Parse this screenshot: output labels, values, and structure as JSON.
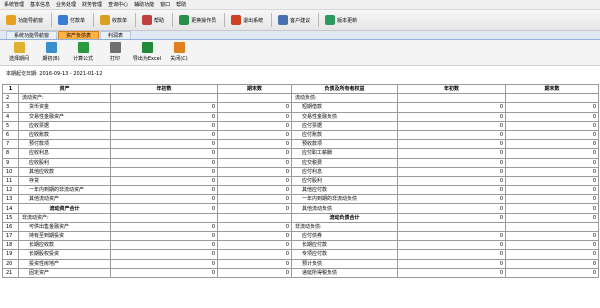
{
  "menu": [
    "系统管理",
    "基本信息",
    "业务处理",
    "财务管理",
    "查询中心",
    "辅助功能",
    "窗口",
    "帮助"
  ],
  "toolbar": [
    {
      "label": "功能导航窗",
      "icon": "home-icon",
      "color": "#e8a020"
    },
    {
      "label": "付款单",
      "icon": "payment-icon",
      "color": "#3a7bd5"
    },
    {
      "label": "收款单",
      "icon": "receipt-icon",
      "color": "#d9a020"
    },
    {
      "label": "帮助",
      "icon": "help-icon",
      "color": "#c04040"
    },
    {
      "label": "更换操作员",
      "icon": "switch-user-icon",
      "color": "#2a8f4a"
    },
    {
      "label": "退出系统",
      "icon": "exit-icon",
      "color": "#d04020"
    },
    {
      "label": "客户建议",
      "icon": "suggestion-icon",
      "color": "#4a6fb0"
    },
    {
      "label": "版本更新",
      "icon": "update-icon",
      "color": "#2a9a60"
    }
  ],
  "tabs": [
    "系统功能导航窗",
    "资产负债表",
    "利润表"
  ],
  "active_tab": 1,
  "toolbar2": [
    {
      "label": "选择期间",
      "icon": "calendar-icon",
      "color": "#e0b030"
    },
    {
      "label": "期初(B)",
      "icon": "refresh-icon",
      "color": "#3a8fd0"
    },
    {
      "label": "计算公式",
      "icon": "formula-icon",
      "color": "#2a9a40"
    },
    {
      "label": "打印",
      "icon": "print-icon",
      "color": "#707070"
    },
    {
      "label": "导出为Excel",
      "icon": "excel-icon",
      "color": "#1f8a3a"
    },
    {
      "label": "关闭(C)",
      "icon": "close-icon",
      "color": "#e08020"
    }
  ],
  "period_text": "本期起讫日期: 2016-09-13 - 2021-01-12",
  "headers": [
    "资产",
    "年初数",
    "期末数",
    "负债及所有者权益",
    "年初数",
    "期末数"
  ],
  "rows": [
    {
      "no": "2",
      "a": "流动资产:",
      "a_style": "i0",
      "a1": "",
      "a2": "",
      "b": "流动负债:",
      "b_style": "i0",
      "b1": "",
      "b2": ""
    },
    {
      "no": "3",
      "a": "货币资金",
      "a_style": "i1",
      "a1": "0",
      "a2": "0",
      "b": "短期借款",
      "b_style": "i1",
      "b1": "0",
      "b2": "0"
    },
    {
      "no": "4",
      "a": "交易性金融资产",
      "a_style": "i1",
      "a1": "0",
      "a2": "0",
      "b": "交易性金融负债",
      "b_style": "i1",
      "b1": "0",
      "b2": "0"
    },
    {
      "no": "5",
      "a": "应收票据",
      "a_style": "i1",
      "a1": "0",
      "a2": "0",
      "b": "应付票据",
      "b_style": "i1",
      "b1": "0",
      "b2": "0"
    },
    {
      "no": "6",
      "a": "应收账款",
      "a_style": "i1",
      "a1": "0",
      "a2": "0",
      "b": "应付账款",
      "b_style": "i1",
      "b1": "0",
      "b2": "0"
    },
    {
      "no": "7",
      "a": "预付款项",
      "a_style": "i1",
      "a1": "0",
      "a2": "0",
      "b": "预收款项",
      "b_style": "i1",
      "b1": "0",
      "b2": "0"
    },
    {
      "no": "8",
      "a": "应收利息",
      "a_style": "i1",
      "a1": "0",
      "a2": "0",
      "b": "应付职工薪酬",
      "b_style": "i1",
      "b1": "0",
      "b2": "0"
    },
    {
      "no": "9",
      "a": "应收股利",
      "a_style": "i1",
      "a1": "0",
      "a2": "0",
      "b": "应交税费",
      "b_style": "i1",
      "b1": "0",
      "b2": "0"
    },
    {
      "no": "10",
      "a": "其他应收款",
      "a_style": "i1",
      "a1": "0",
      "a2": "0",
      "b": "应付利息",
      "b_style": "i1",
      "b1": "0",
      "b2": "0"
    },
    {
      "no": "11",
      "a": "存货",
      "a_style": "i1",
      "a1": "0",
      "a2": "0",
      "b": "应付股利",
      "b_style": "i1",
      "b1": "0",
      "b2": "0"
    },
    {
      "no": "12",
      "a": "一年内到期的非流动资产",
      "a_style": "i1",
      "a1": "0",
      "a2": "0",
      "b": "其他应付款",
      "b_style": "i1",
      "b1": "0",
      "b2": "0"
    },
    {
      "no": "13",
      "a": "其他流动资产",
      "a_style": "i1",
      "a1": "0",
      "a2": "0",
      "b": "一年内到期的非流动负债",
      "b_style": "i1",
      "b1": "0",
      "b2": "0"
    },
    {
      "no": "14",
      "a": "流动资产合计",
      "a_style": "bold",
      "a1": "0",
      "a2": "0",
      "b": "其他流动负债",
      "b_style": "i1",
      "b1": "0",
      "b2": "0"
    },
    {
      "no": "15",
      "a": "非流动资产:",
      "a_style": "i0",
      "a1": "",
      "a2": "",
      "b": "流动负债合计",
      "b_style": "bold",
      "b1": "0",
      "b2": "0"
    },
    {
      "no": "16",
      "a": "可供出售金融资产",
      "a_style": "i1",
      "a1": "0",
      "a2": "0",
      "b": "非流动负债:",
      "b_style": "i0",
      "b1": "",
      "b2": ""
    },
    {
      "no": "17",
      "a": "持有至到期投资",
      "a_style": "i1",
      "a1": "0",
      "a2": "0",
      "b": "应付债券",
      "b_style": "i1",
      "b1": "0",
      "b2": "0"
    },
    {
      "no": "18",
      "a": "长期应收款",
      "a_style": "i1",
      "a1": "0",
      "a2": "0",
      "b": "长期应付款",
      "b_style": "i1",
      "b1": "0",
      "b2": "0"
    },
    {
      "no": "19",
      "a": "长期股权投资",
      "a_style": "i1",
      "a1": "0",
      "a2": "0",
      "b": "专项应付款",
      "b_style": "i1",
      "b1": "0",
      "b2": "0"
    },
    {
      "no": "20",
      "a": "投资性房地产",
      "a_style": "i1",
      "a1": "0",
      "a2": "0",
      "b": "预计负债",
      "b_style": "i1",
      "b1": "0",
      "b2": "0"
    },
    {
      "no": "21",
      "a": "固定资产",
      "a_style": "i1",
      "a1": "0",
      "a2": "0",
      "b": "递延所得税负债",
      "b_style": "i1",
      "b1": "0",
      "b2": "0"
    }
  ]
}
